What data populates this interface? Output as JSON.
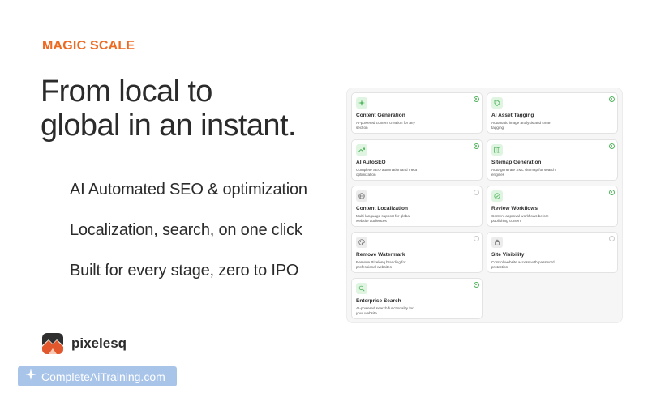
{
  "hero": {
    "eyebrow": "MAGIC SCALE",
    "headline_line1": "From local to",
    "headline_line2": "global in an instant."
  },
  "features": [
    "AI Automated SEO & optimization",
    "Localization, search, on one click",
    "Built for every stage, zero to IPO"
  ],
  "brand": {
    "name": "pixelesq",
    "logo_icon": "mountain-sun-logo"
  },
  "watermark": {
    "text": "CompleteAiTraining.com",
    "icon": "sparkle-icon"
  },
  "colors": {
    "accent": "#ec6a21",
    "enabled": "#52b45d",
    "watermark_bg": "#a9c4e9"
  },
  "cards": [
    {
      "title": "Content Generation",
      "desc": "AI-powered content creation for any section",
      "icon": "sparkle-icon",
      "enabled": true
    },
    {
      "title": "AI Asset Tagging",
      "desc": "Automatic image analysis and smart tagging",
      "icon": "tag-icon",
      "enabled": true
    },
    {
      "title": "AI AutoSEO",
      "desc": "Complete SEO automation and meta optimization",
      "icon": "trend-up-icon",
      "enabled": true
    },
    {
      "title": "Sitemap Generation",
      "desc": "Auto-generate XML sitemap for search engines",
      "icon": "map-icon",
      "enabled": true
    },
    {
      "title": "Content Localization",
      "desc": "Multi-language support for global website audiences",
      "icon": "globe-icon",
      "enabled": false
    },
    {
      "title": "Review Workflows",
      "desc": "Content approval workflows before publishing content",
      "icon": "check-circle-icon",
      "enabled": true
    },
    {
      "title": "Remove Watermark",
      "desc": "Remove Pixelesq branding for professional websites",
      "icon": "palette-icon",
      "enabled": false
    },
    {
      "title": "Site Visibility",
      "desc": "Control website access with password protection",
      "icon": "lock-icon",
      "enabled": false
    },
    {
      "title": "Enterprise Search",
      "desc": "AI-powered search functionality for your website",
      "icon": "search-icon",
      "enabled": true
    }
  ]
}
